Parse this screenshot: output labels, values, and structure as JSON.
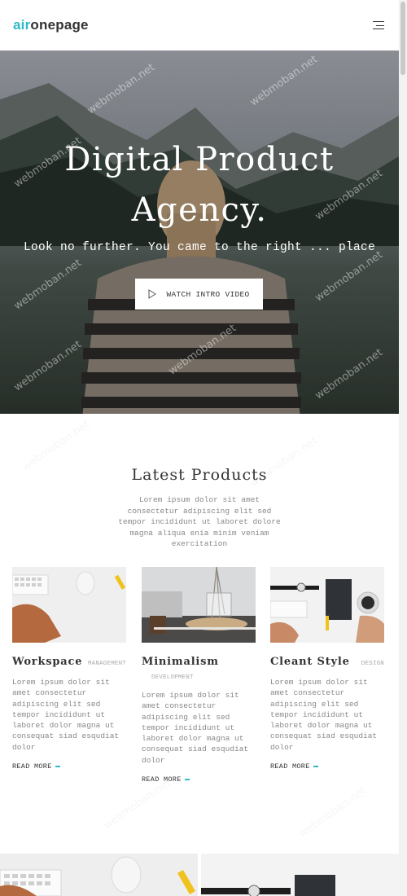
{
  "header": {
    "logo_part1": "air",
    "logo_part2": "onepage",
    "menu_icon": "hamburger-icon"
  },
  "hero": {
    "title_line1": "Digital Product",
    "title_line2": "Agency.",
    "subtitle": "Look no further. You came to the right ... place",
    "button_label": "WATCH INTRO VIDEO",
    "button_icon": "play-icon"
  },
  "products": {
    "title": "Latest Products",
    "description": "Lorem ipsum dolor sit amet consectetur adipiscing elit sed tempor incididunt ut laboret dolore magna aliqua enia minim veniam exercitation",
    "items": [
      {
        "title": "Workspace",
        "category": "MANAGEMENT",
        "text": "Lorem ipsum dolor sit amet consectetur adipiscing elit sed tempor incididunt ut laboret dolor magna ut consequat siad esqudiat dolor",
        "more": "READ MORE"
      },
      {
        "title": "Minimalism",
        "category": "DEVELOPMENT",
        "text": "Lorem ipsum dolor sit amet consectetur adipiscing elit sed tempor incididunt ut laboret dolor magna ut consequat siad esqudiat dolor",
        "more": "READ MORE"
      },
      {
        "title": "Cleant Style",
        "category": "DESIGN",
        "text": "Lorem ipsum dolor sit amet consectetur adipiscing elit sed tempor incididunt ut laboret dolor magna ut consequat siad esqudiat dolor",
        "more": "READ MORE"
      }
    ]
  },
  "watermark": "webmoban.net",
  "colors": {
    "accent": "#2fb9c6",
    "text_dark": "#333333",
    "text_muted": "#888888"
  }
}
